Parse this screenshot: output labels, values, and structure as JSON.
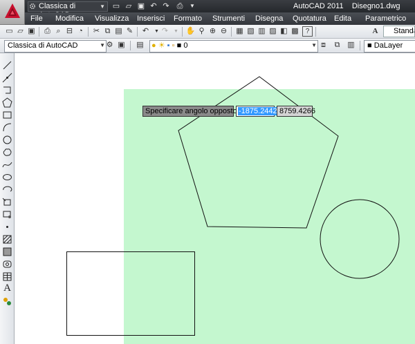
{
  "app": {
    "title": "AutoCAD 2011",
    "document": "Disegno1.dwg",
    "workspace": "Classica di AutoCAD"
  },
  "menu": [
    "File",
    "Modifica",
    "Visualizza",
    "Inserisci",
    "Formato",
    "Strumenti",
    "Disegna",
    "Quotatura",
    "Edita",
    "Parametrico"
  ],
  "toolbar": {
    "style_label": "Standa",
    "workspace_combo": "Classica di AutoCAD",
    "layer_name": "0",
    "color_value": "DaLayer"
  },
  "dynamic_input": {
    "prompt": "Specificare angolo opposto:",
    "x_value": "-1875.2442",
    "y_value": "8759.4266"
  },
  "colors": {
    "selection": "#c4f7cf",
    "prompt_bg": "#8a8a8a",
    "highlight": "#3399ff"
  },
  "icons": [
    "new-icon",
    "open-icon",
    "save-icon",
    "print-icon",
    "preview-icon",
    "plot-icon",
    "publish-icon",
    "cut-icon",
    "copy-icon",
    "paste-icon",
    "matchprop-icon",
    "undo-icon",
    "redo-icon",
    "pan-icon",
    "zoom-realtime-icon",
    "zoom-window-icon",
    "zoom-previous-icon",
    "properties-icon",
    "design-center-icon",
    "tool-palettes-icon",
    "sheet-set-icon",
    "markup-icon",
    "calculator-icon",
    "help-icon",
    "text-style-icon"
  ]
}
